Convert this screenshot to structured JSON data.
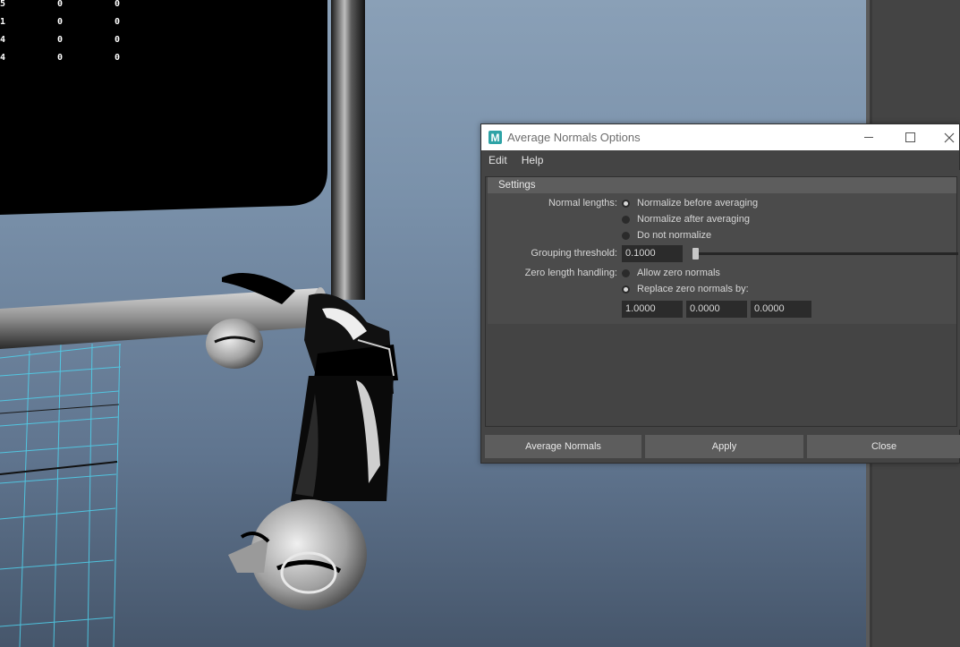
{
  "hud": {
    "rows": [
      [
        "5",
        "0",
        "0"
      ],
      [
        "1",
        "0",
        "0"
      ],
      [
        "4",
        "0",
        "0"
      ],
      [
        "4",
        "0",
        "0"
      ]
    ]
  },
  "dialog": {
    "title": "Average Normals Options",
    "icon_letter": "M",
    "icon_name": "maya-icon",
    "menu": [
      "Edit",
      "Help"
    ],
    "section_title": "Settings",
    "normal_lengths": {
      "label": "Normal lengths:",
      "options": [
        "Normalize before averaging",
        "Normalize after averaging",
        "Do not normalize"
      ],
      "selected_index": 0
    },
    "grouping_threshold": {
      "label": "Grouping threshold:",
      "value": "0.1000",
      "slider_fraction": 0.0
    },
    "zero_length": {
      "label": "Zero length handling:",
      "options": [
        "Allow zero normals",
        "Replace zero normals by:"
      ],
      "selected_index": 1,
      "values": [
        "1.0000",
        "0.0000",
        "0.0000"
      ]
    },
    "buttons": {
      "average": "Average Normals",
      "apply": "Apply",
      "close": "Close"
    }
  },
  "colors": {
    "dialog_bg": "#444444",
    "section_header": "#5d5d5d",
    "field_bg": "#2b2b2b",
    "grid_line": "#4fd3ee",
    "app_icon": "#2ea3a6"
  }
}
